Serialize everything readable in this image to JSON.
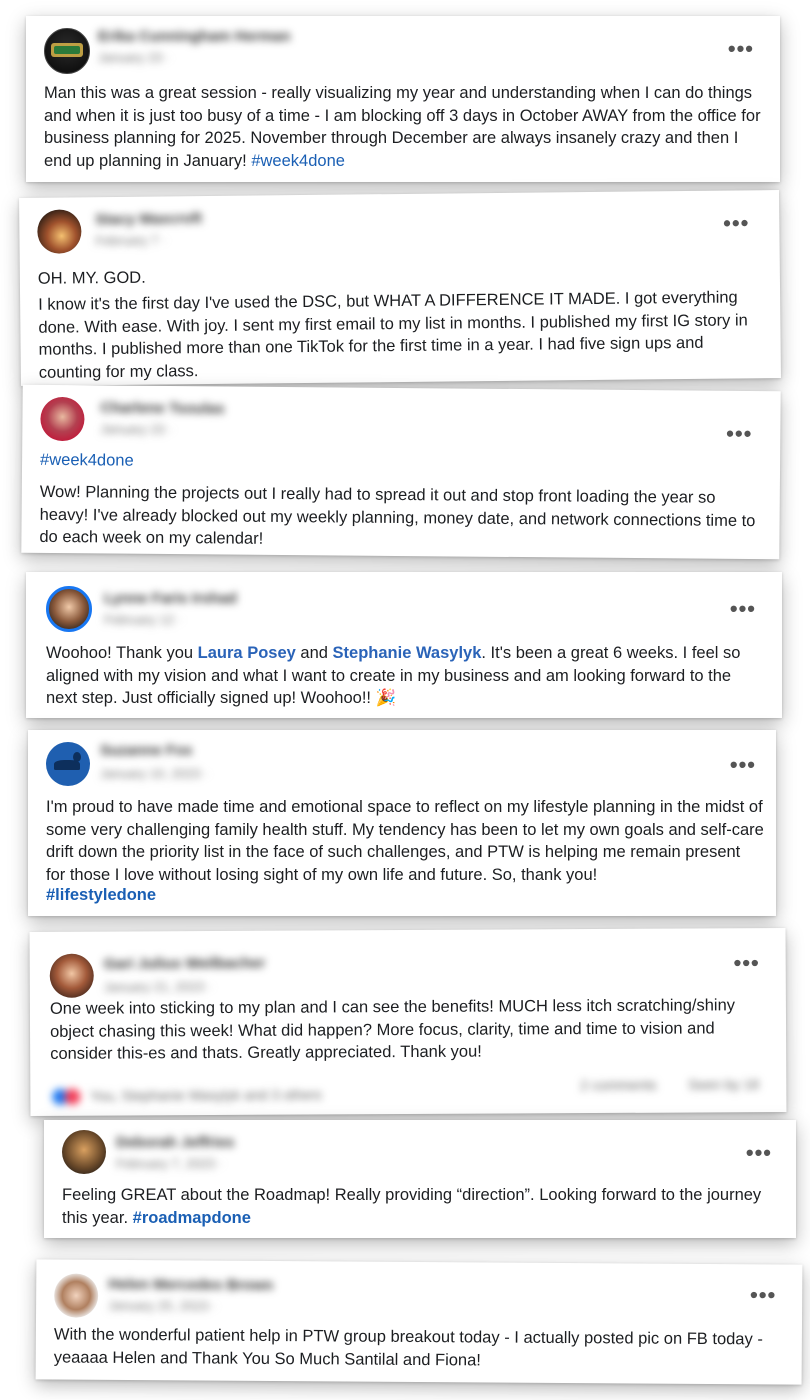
{
  "posts": [
    {
      "author": "Erika Cunningham Herman",
      "date": "January 23 · ",
      "body": "Man this was a great session - really visualizing my year and understanding when I can do things and when it is just too busy of a time - I am blocking off 3 days in October AWAY from the office for business planning for 2025. November through December are always insanely crazy and then I end up planning in January!",
      "tag": "#week4done",
      "more_icon": "more-horizontal-icon"
    },
    {
      "author": "Stacy Maxcroft",
      "date": "February 7 · ",
      "intro": "OH. MY. GOD.",
      "body": "I know it's the first day I've used the DSC, but WHAT A DIFFERENCE IT MADE. I got everything done. With ease. With joy. I sent my first email to my list in months. I published my first IG story in months. I published more than one TikTok for the first time in a year. I had five sign ups and counting for my class."
    },
    {
      "author": "Charlene Tsoulas",
      "date": "January 23 · ",
      "tag": "#week4done",
      "body": "Wow! Planning the projects out I really had to spread it out and stop front loading the year so heavy! I've already blocked out my weekly planning, money date, and network connections time to do each week on my calendar!"
    },
    {
      "author": "Lynne Faris Irshad",
      "date": "February 12 · ",
      "body_start": "Woohoo! Thank you ",
      "mention1": "Laura Posey",
      "body_and": " and ",
      "mention2": "Stephanie Wasylyk",
      "body_end": ". It's been a great 6 weeks. I feel so aligned with my vision and what I want to create in my business and am looking forward to the next step. Just officially signed up! Woohoo!! 🎉"
    },
    {
      "author": "Suzanne Fox",
      "date": "January 10, 2023 · ",
      "body": "I'm proud to have made time and emotional space to reflect on my lifestyle planning in the midst of some very challenging family health stuff. My tendency has  been to let my own goals and self-care drift down the priority list in the face of such challenges, and PTW is helping me remain present for those I love without losing sight of my own life and future. So, thank you!",
      "tag": "#lifestyledone"
    },
    {
      "author": "Gari Julius Weilbacher",
      "date": "January 21, 2023 · ",
      "body": "One week into sticking to my plan and I can see the benefits! MUCH less itch scratching/shiny object chasing this week! What did happen? More focus, clarity, time and time to vision and consider this-es and thats. Greatly appreciated. Thank you!",
      "reactions": "You, Stephanie Wasylyk and 3 others",
      "comments": "2 comments",
      "seen": "Seen by 18"
    },
    {
      "author": "Deborah Jeffries",
      "date": "February 7, 2023 · ",
      "body": "Feeling GREAT about the Roadmap! Really providing “direction”. Looking forward to the journey this year.",
      "tag": "#roadmapdone"
    },
    {
      "author": "Helen Mercedes Brown",
      "date": "January 25, 2023 · ",
      "body": "With the wonderful patient help in PTW group breakout today - I actually posted pic on FB today - yeaaaa Helen and Thank You So Much Santilal and Fiona!"
    }
  ],
  "more_label": "•••",
  "colors": {
    "link": "#1a5fb4",
    "text": "#1c1e21",
    "muted": "#777777"
  }
}
